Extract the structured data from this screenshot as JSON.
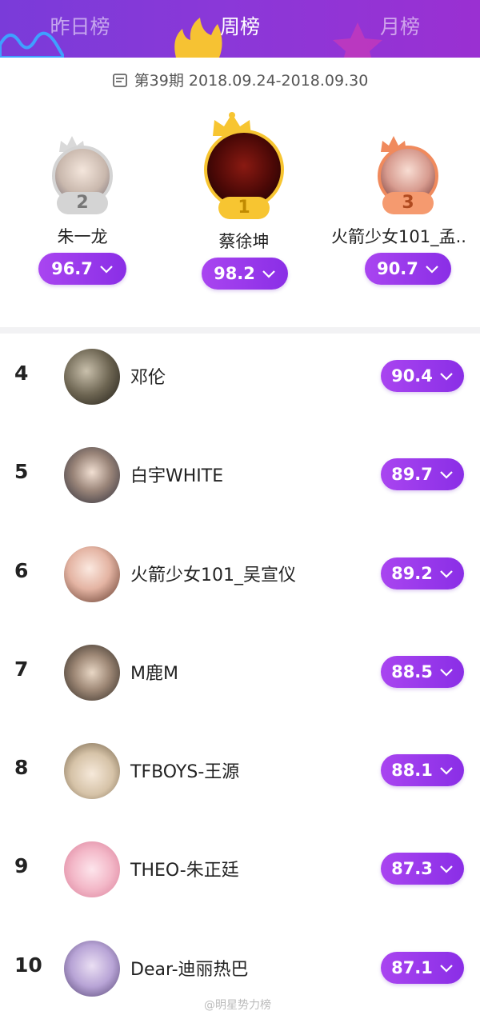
{
  "tabs": [
    {
      "label": "昨日榜"
    },
    {
      "label": "周榜"
    },
    {
      "label": "月榜"
    }
  ],
  "period": {
    "text": "第39期  2018.09.24-2018.09.30"
  },
  "podium": [
    {
      "rank": "2",
      "name": "朱一龙",
      "score": "96.7"
    },
    {
      "rank": "1",
      "name": "蔡徐坤",
      "score": "98.2"
    },
    {
      "rank": "3",
      "name": "火箭少女101_孟..",
      "score": "90.7"
    }
  ],
  "list": [
    {
      "rank": "4",
      "name": "邓伦",
      "score": "90.4"
    },
    {
      "rank": "5",
      "name": "白宇WHITE",
      "score": "89.7"
    },
    {
      "rank": "6",
      "name": "火箭少女101_吴宣仪",
      "score": "89.2"
    },
    {
      "rank": "7",
      "name": "M鹿M",
      "score": "88.5"
    },
    {
      "rank": "8",
      "name": "TFBOYS-王源",
      "score": "88.1"
    },
    {
      "rank": "9",
      "name": "THEO-朱正廷",
      "score": "87.3"
    },
    {
      "rank": "10",
      "name": "Dear-迪丽热巴",
      "score": "87.1"
    }
  ],
  "watermark": "@明星势力榜",
  "colors": {
    "accent": "#8a2ee6",
    "header": "#8a38d8",
    "gold": "#f7c531",
    "silver": "#d4d4d4",
    "bronze": "#f08a5d"
  }
}
